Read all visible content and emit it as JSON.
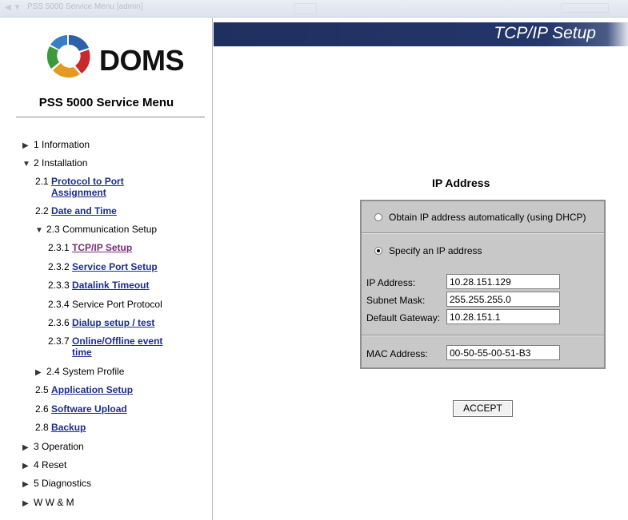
{
  "browser": {
    "title_text": "PSS 5000 Service Menu [admin]"
  },
  "sidebar": {
    "logo_text": "DOMS",
    "menu_title": "PSS 5000 Service Menu",
    "items": [
      {
        "num": "1",
        "label": "Information"
      },
      {
        "num": "2",
        "label": "Installation"
      },
      {
        "num": "2.1",
        "label": "Protocol to Port Assignment"
      },
      {
        "num": "2.2",
        "label": "Date and Time"
      },
      {
        "num": "2.3",
        "label": "Communication Setup"
      },
      {
        "num": "2.3.1",
        "label": "TCP/IP Setup"
      },
      {
        "num": "2.3.2",
        "label": "Service Port Setup"
      },
      {
        "num": "2.3.3",
        "label": "Datalink Timeout"
      },
      {
        "num": "2.3.4",
        "label": "Service Port Protocol"
      },
      {
        "num": "2.3.6",
        "label": "Dialup setup / test"
      },
      {
        "num": "2.3.7",
        "label": "Online/Offline event time"
      },
      {
        "num": "2.4",
        "label": "System Profile"
      },
      {
        "num": "2.5",
        "label": "Application Setup"
      },
      {
        "num": "2.6",
        "label": "Software Upload"
      },
      {
        "num": "2.8",
        "label": "Backup"
      },
      {
        "num": "3",
        "label": "Operation"
      },
      {
        "num": "4",
        "label": "Reset"
      },
      {
        "num": "5",
        "label": "Diagnostics"
      },
      {
        "num": "",
        "label": "W W & M"
      }
    ]
  },
  "main": {
    "page_title": "TCP/IP Setup",
    "section_title": "IP Address",
    "option_dhcp": "Obtain IP address automatically (using DHCP)",
    "option_static": "Specify an IP address",
    "selected_option": "static",
    "ip_label": "IP Address:",
    "ip_value": "10.28.151.129",
    "mask_label": "Subnet Mask:",
    "mask_value": "255.255.255.0",
    "gateway_label": "Default Gateway:",
    "gateway_value": "10.28.151.1",
    "mac_label": "MAC Address:",
    "mac_value": "00-50-55-00-51-B3",
    "accept_label": "ACCEPT"
  },
  "colors": {
    "link": "#1b2d8c",
    "visited_link": "#7a2a7a",
    "header": "#1f2f5e",
    "panel": "#c8c8c8"
  }
}
